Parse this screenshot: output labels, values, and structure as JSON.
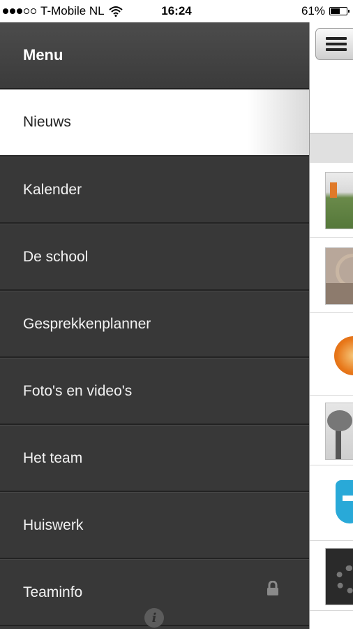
{
  "status_bar": {
    "carrier": "T-Mobile NL",
    "time": "16:24",
    "battery_percent": "61%",
    "battery_level": 0.61,
    "signal_bars_filled": 3,
    "signal_bars_total": 5
  },
  "menu": {
    "title": "Menu",
    "items": [
      {
        "label": "Nieuws",
        "active": true
      },
      {
        "label": "Kalender"
      },
      {
        "label": "De school"
      },
      {
        "label": "Gesprekkenplanner"
      },
      {
        "label": "Foto's en video's"
      },
      {
        "label": "Het team"
      },
      {
        "label": "Huiswerk"
      },
      {
        "label": "Teaminfo",
        "locked": true
      }
    ],
    "info_label": "i"
  },
  "content": {
    "menu_button_icon": "hamburger-icon",
    "thumbnails": [
      "football-field-photo",
      "rings-photo",
      "orange-photo",
      "tree-photo",
      "blue-logo",
      "gears-photo"
    ]
  },
  "colors": {
    "drawer_bg": "#3a3a3a",
    "active_item_bg": "#ffffff",
    "menu_text": "#f2f2f2"
  }
}
